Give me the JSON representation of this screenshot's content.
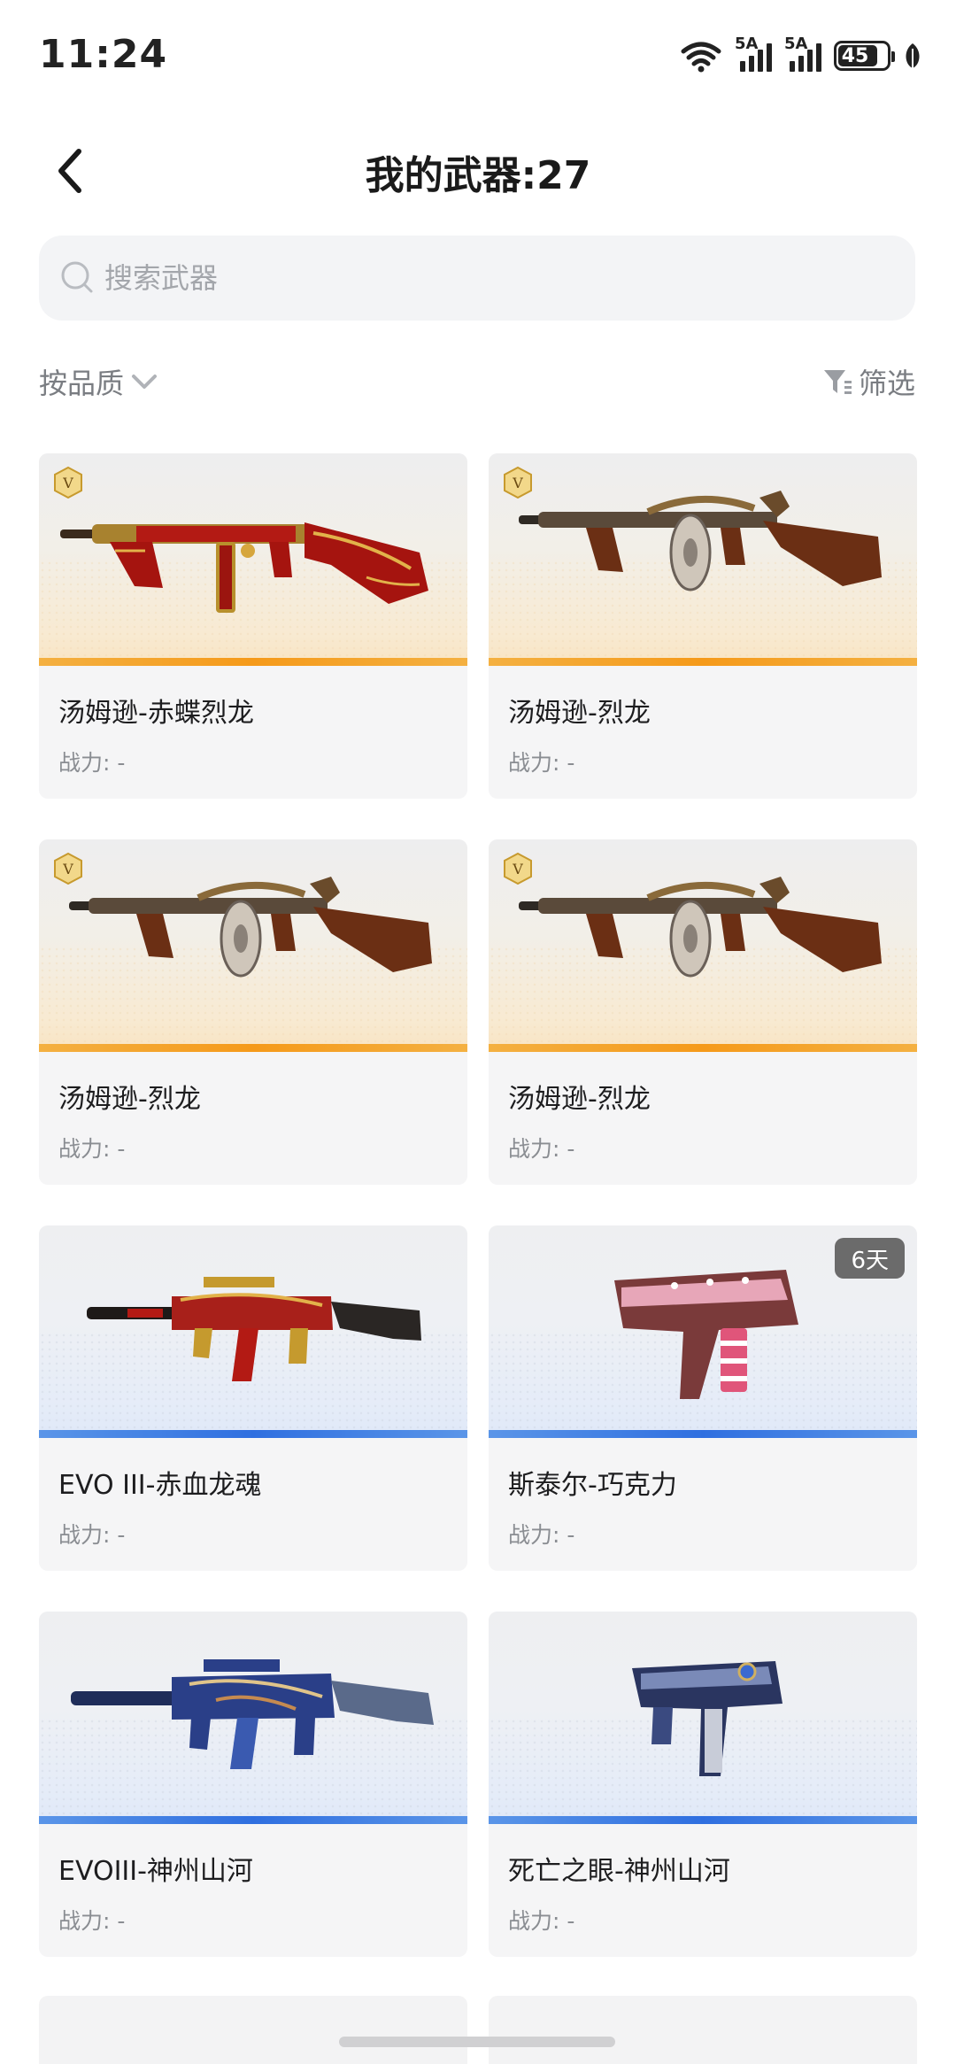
{
  "status_bar": {
    "time": "11:24",
    "sim1": "5A",
    "sim2": "5A",
    "battery": "45"
  },
  "header": {
    "title": "我的武器:27"
  },
  "search": {
    "placeholder": "搜索武器",
    "value": ""
  },
  "toolbar": {
    "sort_label": "按品质",
    "filter_label": "筛选"
  },
  "colors": {
    "gold_rarity": "#f59a1a",
    "blue_rarity": "#2f6fe0",
    "card_bg": "#f5f5f6"
  },
  "weapons": [
    {
      "name": "汤姆逊-赤蝶烈龙",
      "power": "战力: -",
      "rarity": "gold",
      "badge": "V",
      "icon": "tommy-gun-red-gold-icon"
    },
    {
      "name": "汤姆逊-烈龙",
      "power": "战力: -",
      "rarity": "gold",
      "badge": "V",
      "icon": "tommy-gun-dragon-icon"
    },
    {
      "name": "汤姆逊-烈龙",
      "power": "战力: -",
      "rarity": "gold",
      "badge": "V",
      "icon": "tommy-gun-dragon-icon"
    },
    {
      "name": "汤姆逊-烈龙",
      "power": "战力: -",
      "rarity": "gold",
      "badge": "V",
      "icon": "tommy-gun-dragon-icon"
    },
    {
      "name": "EVO III-赤血龙魂",
      "power": "战力: -",
      "rarity": "blue",
      "icon": "evo3-red-gold-icon"
    },
    {
      "name": "斯泰尔-巧克力",
      "power": "战力: -",
      "rarity": "blue",
      "days_left": "6天",
      "icon": "steyr-chocolate-icon"
    },
    {
      "name": "EVOIII-神州山河",
      "power": "战力: -",
      "rarity": "blue",
      "icon": "evo3-blue-landscape-icon"
    },
    {
      "name": "死亡之眼-神州山河",
      "power": "战力: -",
      "rarity": "blue",
      "icon": "deathseye-blue-landscape-icon"
    }
  ]
}
